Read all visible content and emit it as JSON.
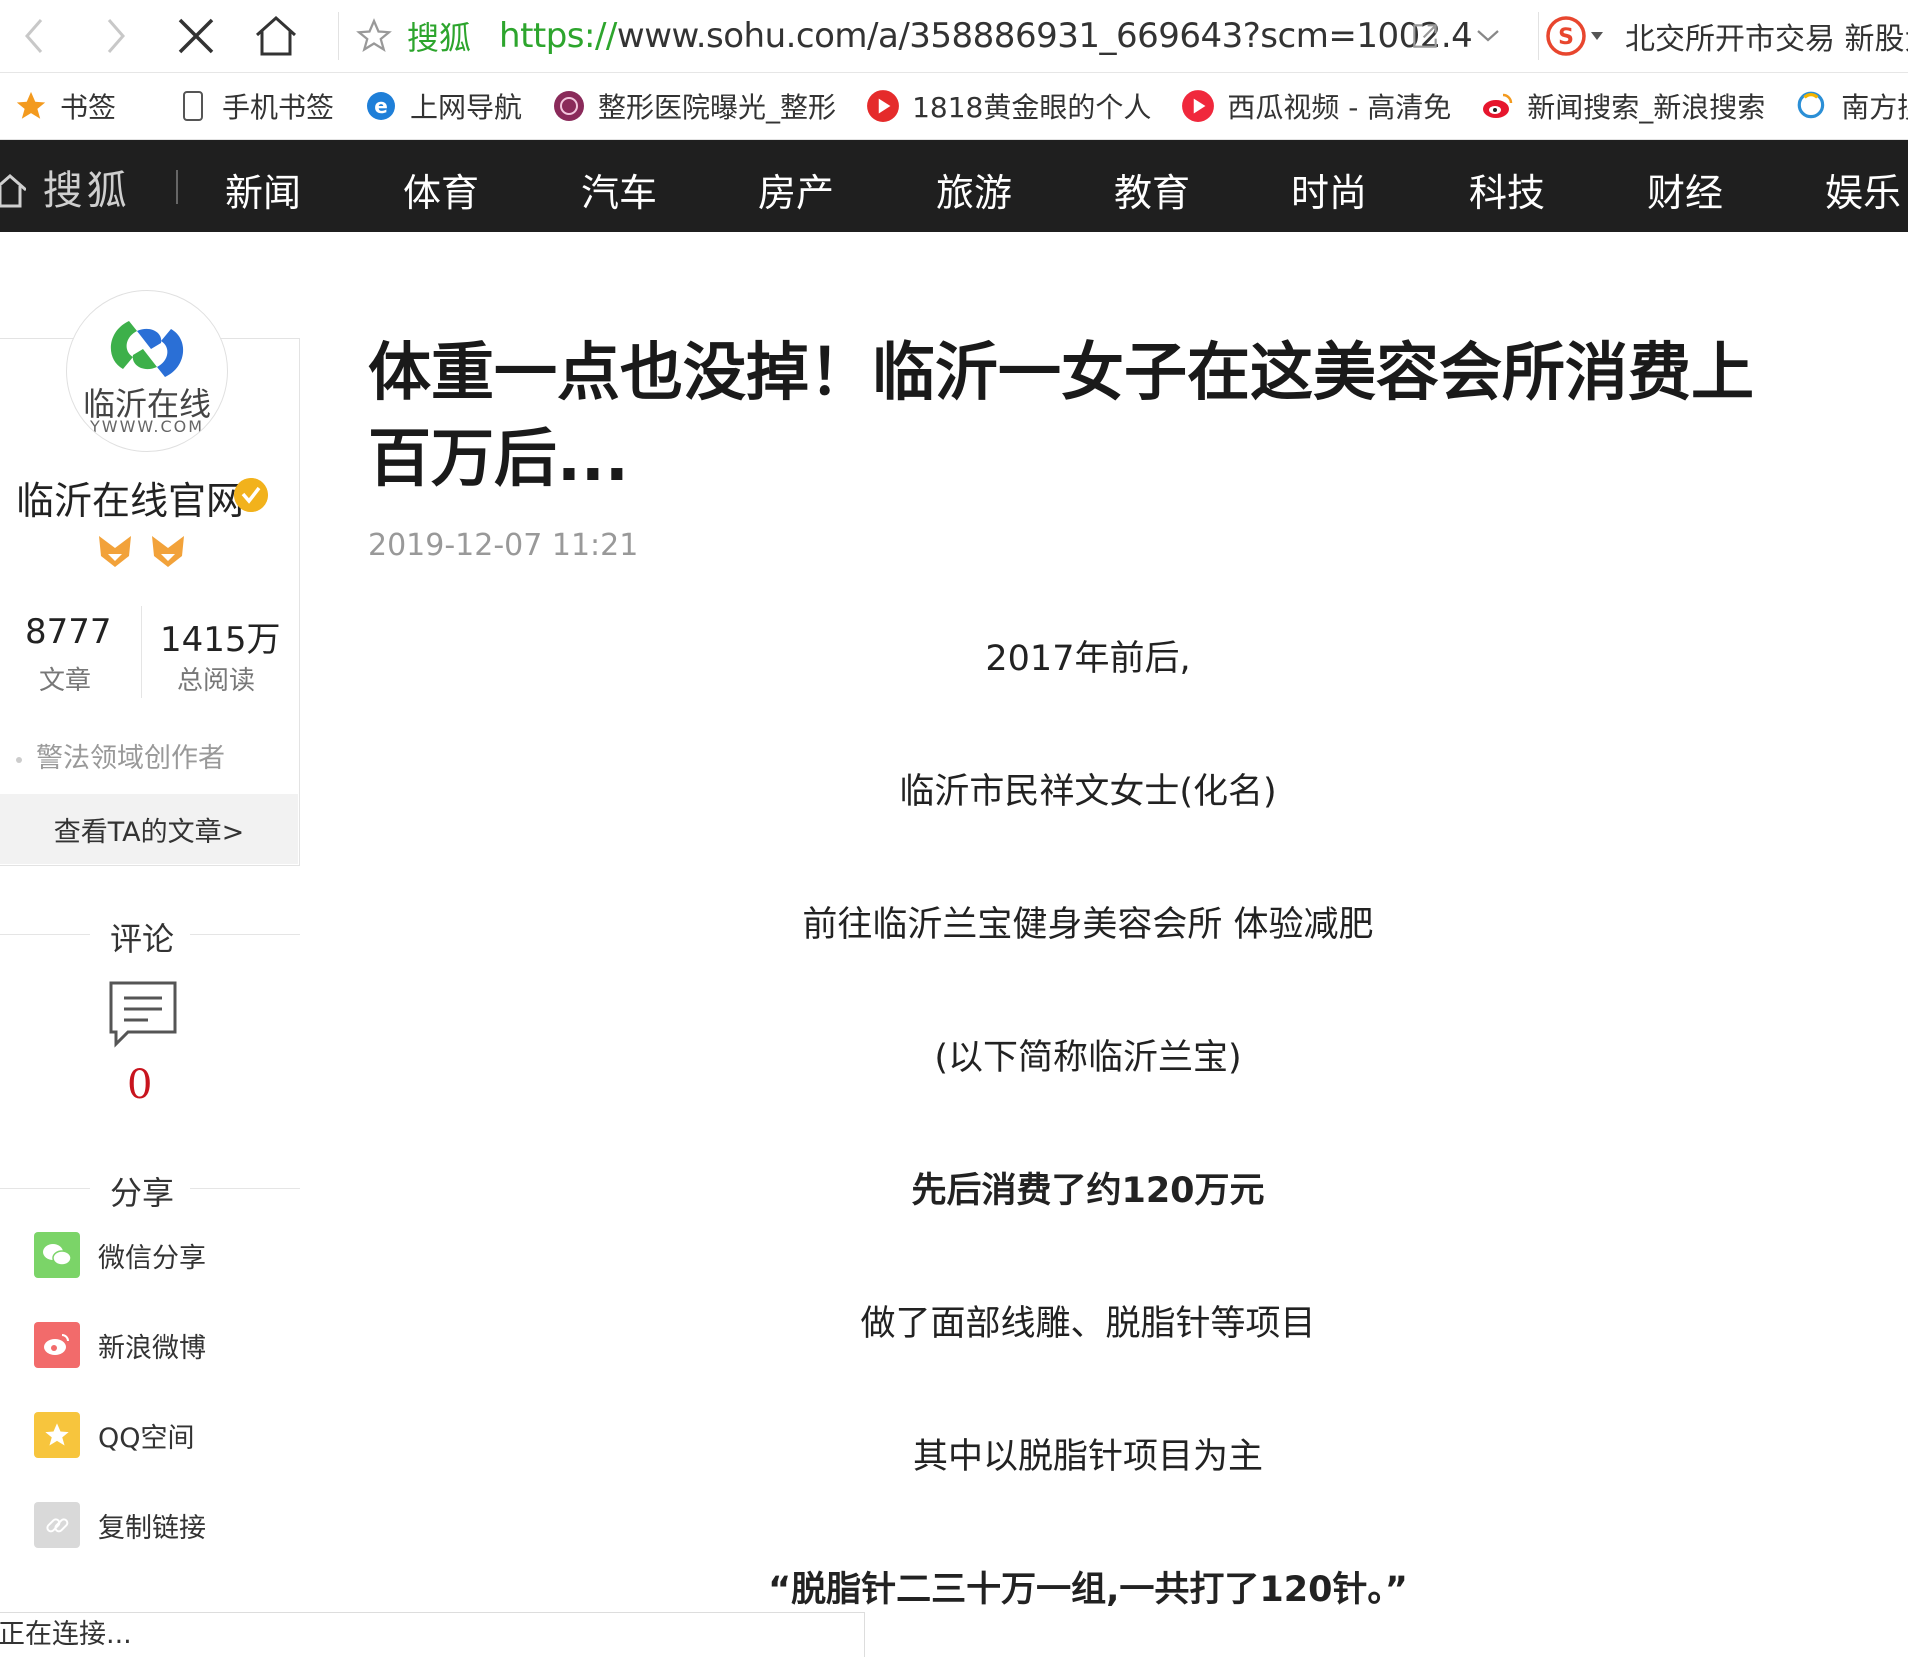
{
  "browser": {
    "site_name": "搜狐",
    "url_protocol": "https://",
    "url_rest": "www.sohu.com/a/358886931_669643?scm=1002.4",
    "news_ticker": "北交所开市交易 新股大"
  },
  "bookmarks": [
    {
      "label": "书签",
      "icon": "star-icon"
    },
    {
      "label": "手机书签",
      "icon": "phone-icon"
    },
    {
      "label": "上网导航",
      "icon": "ie-icon"
    },
    {
      "label": "整形医院曝光_整形",
      "icon": "hospital-icon"
    },
    {
      "label": "1818黄金眼的个人",
      "icon": "play-icon"
    },
    {
      "label": "西瓜视频 - 高清免",
      "icon": "play-icon"
    },
    {
      "label": "新闻搜索_新浪搜索",
      "icon": "weibo-icon"
    },
    {
      "label": "南方搜索_南",
      "icon": "search-icon"
    }
  ],
  "sohu_nav": {
    "logo": "搜狐",
    "items": [
      "新闻",
      "体育",
      "汽车",
      "房产",
      "旅游",
      "教育",
      "时尚",
      "科技",
      "财经",
      "娱乐"
    ]
  },
  "author": {
    "avatar_text": "临沂在线",
    "avatar_sub": "YWWW.COM",
    "name": "临沂在线官网",
    "articles_count": "8777",
    "articles_label": "文章",
    "reads_count": "1415万",
    "reads_label": "总阅读",
    "tag": "警法领域创作者",
    "view_articles": "查看TA的文章>"
  },
  "comments": {
    "title": "评论",
    "count": "0"
  },
  "share": {
    "title": "分享",
    "items": [
      {
        "label": "微信分享",
        "color": "#7bd468"
      },
      {
        "label": "新浪微博",
        "color": "#f26b6b"
      },
      {
        "label": "QQ空间",
        "color": "#f7c53d"
      },
      {
        "label": "复制链接",
        "color": "#d9d9d9"
      }
    ]
  },
  "article": {
    "title": "体重一点也没掉！临沂一女子在这美容会所消费上百万后...",
    "date": "2019-12-07 11:21",
    "paragraphs": [
      {
        "text": "2017年前后,",
        "bold": false
      },
      {
        "text": "临沂市民祥文女士(化名)",
        "bold": false
      },
      {
        "text": "前往临沂兰宝健身美容会所 体验减肥",
        "bold": false
      },
      {
        "text": "(以下简称临沂兰宝)",
        "bold": false
      },
      {
        "text": "先后消费了约120万元",
        "bold": true
      },
      {
        "text": "做了面部线雕、脱脂针等项目",
        "bold": false
      },
      {
        "text": "其中以脱脂针项目为主",
        "bold": false
      },
      {
        "text": "“脱脂针二三十万一组,一共打了120针。”",
        "bold": true
      }
    ]
  },
  "status_bar": "正在连接..."
}
